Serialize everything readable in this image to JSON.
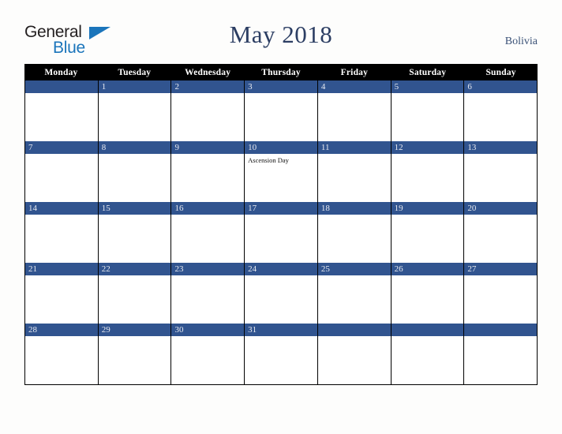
{
  "branding": {
    "logo_primary": "General",
    "logo_secondary": "Blue",
    "logo_triangle_icon": "triangle-icon",
    "primary_color": "#1b75bb"
  },
  "header": {
    "title": "May 2018",
    "month": "May",
    "year": "2018",
    "country": "Bolivia",
    "title_color": "#2c3e63",
    "country_color": "#3b5277"
  },
  "calendar": {
    "header_background": "#000000",
    "date_bar_color": "#31548f",
    "cell_background": "#ffffff",
    "grid_line_color": "#000000",
    "weekdays": [
      "Monday",
      "Tuesday",
      "Wednesday",
      "Thursday",
      "Friday",
      "Saturday",
      "Sunday"
    ],
    "weeks": [
      [
        {
          "date": "",
          "events": []
        },
        {
          "date": "1",
          "events": []
        },
        {
          "date": "2",
          "events": []
        },
        {
          "date": "3",
          "events": []
        },
        {
          "date": "4",
          "events": []
        },
        {
          "date": "5",
          "events": []
        },
        {
          "date": "6",
          "events": []
        }
      ],
      [
        {
          "date": "7",
          "events": []
        },
        {
          "date": "8",
          "events": []
        },
        {
          "date": "9",
          "events": []
        },
        {
          "date": "10",
          "events": [
            "Ascension Day"
          ]
        },
        {
          "date": "11",
          "events": []
        },
        {
          "date": "12",
          "events": []
        },
        {
          "date": "13",
          "events": []
        }
      ],
      [
        {
          "date": "14",
          "events": []
        },
        {
          "date": "15",
          "events": []
        },
        {
          "date": "16",
          "events": []
        },
        {
          "date": "17",
          "events": []
        },
        {
          "date": "18",
          "events": []
        },
        {
          "date": "19",
          "events": []
        },
        {
          "date": "20",
          "events": []
        }
      ],
      [
        {
          "date": "21",
          "events": []
        },
        {
          "date": "22",
          "events": []
        },
        {
          "date": "23",
          "events": []
        },
        {
          "date": "24",
          "events": []
        },
        {
          "date": "25",
          "events": []
        },
        {
          "date": "26",
          "events": []
        },
        {
          "date": "27",
          "events": []
        }
      ],
      [
        {
          "date": "28",
          "events": []
        },
        {
          "date": "29",
          "events": []
        },
        {
          "date": "30",
          "events": []
        },
        {
          "date": "31",
          "events": []
        },
        {
          "date": "",
          "events": []
        },
        {
          "date": "",
          "events": []
        },
        {
          "date": "",
          "events": []
        }
      ]
    ]
  }
}
